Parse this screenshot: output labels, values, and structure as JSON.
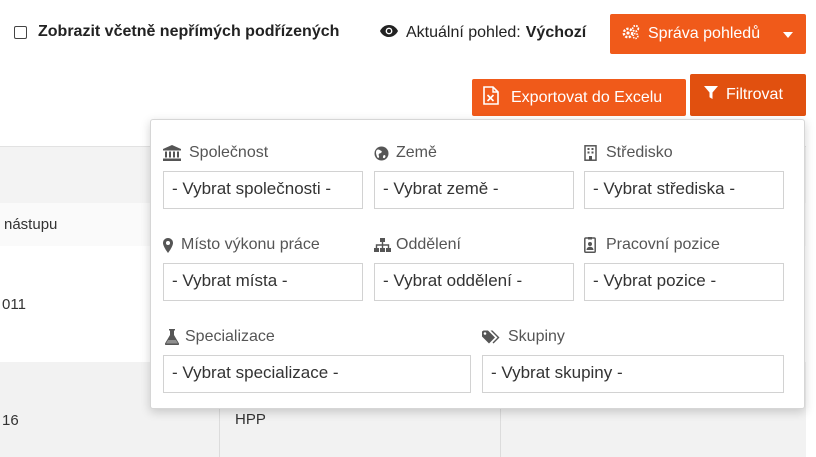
{
  "toolbar": {
    "checkbox_label": "Zobrazit včetně nepřímých podřízených",
    "view_prefix": "Aktuální pohled:",
    "view_name": "Výchozí",
    "manage_views_label": "Správa pohledů",
    "export_label": "Exportovat do Excelu",
    "filter_label": "Filtrovat"
  },
  "table": {
    "header_cell": "nástupu",
    "row1_cell": "011",
    "row2_cell_a": "16",
    "row2_cell_b": "HPP"
  },
  "filters": {
    "company": {
      "label": "Společnost",
      "placeholder": "- Vybrat společnosti -",
      "icon": "bank-icon"
    },
    "country": {
      "label": "Země",
      "placeholder": "- Vybrat země -",
      "icon": "globe-icon"
    },
    "center": {
      "label": "Středisko",
      "placeholder": "- Vybrat střediska -",
      "icon": "building-icon"
    },
    "workplace": {
      "label": "Místo výkonu práce",
      "placeholder": "- Vybrat místa -",
      "icon": "map-marker-icon"
    },
    "department": {
      "label": "Oddělení",
      "placeholder": "- Vybrat oddělení -",
      "icon": "sitemap-icon"
    },
    "position": {
      "label": "Pracovní pozice",
      "placeholder": "- Vybrat pozice -",
      "icon": "id-badge-icon"
    },
    "specialization": {
      "label": "Specializace",
      "placeholder": "- Vybrat specializace -",
      "icon": "flask-icon"
    },
    "groups": {
      "label": "Skupiny",
      "placeholder": "- Vybrat skupiny -",
      "icon": "tags-icon"
    }
  },
  "colors": {
    "accent": "#f05a1a",
    "accent_dark": "#e1500f"
  }
}
